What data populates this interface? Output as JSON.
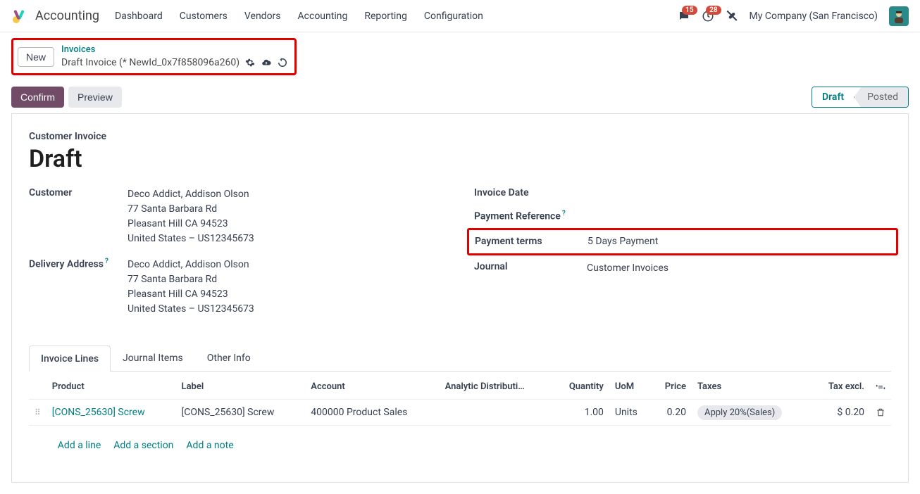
{
  "nav": {
    "app": "Accounting",
    "items": [
      "Dashboard",
      "Customers",
      "Vendors",
      "Accounting",
      "Reporting",
      "Configuration"
    ],
    "msg_badge": "15",
    "activity_badge": "28",
    "company": "My Company (San Francisco)"
  },
  "crumb": {
    "new_btn": "New",
    "parent": "Invoices",
    "current": "Draft Invoice (* NewId_0x7f858096a260)"
  },
  "actions": {
    "confirm": "Confirm",
    "preview": "Preview",
    "status_draft": "Draft",
    "status_posted": "Posted"
  },
  "sheet": {
    "subtitle": "Customer Invoice",
    "title": "Draft",
    "left": {
      "customer_label": "Customer",
      "customer_value": "Deco Addict, Addison Olson\n77 Santa Barbara Rd\nPleasant Hill CA 94523\nUnited States – US12345673",
      "delivery_label": "Delivery Address",
      "delivery_value": "Deco Addict, Addison Olson\n77 Santa Barbara Rd\nPleasant Hill CA 94523\nUnited States – US12345673"
    },
    "right": {
      "invoice_date_label": "Invoice Date",
      "invoice_date_value": "",
      "payref_label": "Payment Reference",
      "payref_value": "",
      "payterms_label": "Payment terms",
      "payterms_value": "5 Days Payment",
      "journal_label": "Journal",
      "journal_value": "Customer Invoices"
    }
  },
  "tabs": [
    "Invoice Lines",
    "Journal Items",
    "Other Info"
  ],
  "table": {
    "headers": {
      "product": "Product",
      "label": "Label",
      "account": "Account",
      "analytic": "Analytic Distributi…",
      "qty": "Quantity",
      "uom": "UoM",
      "price": "Price",
      "taxes": "Taxes",
      "taxexcl": "Tax excl."
    },
    "rows": [
      {
        "product": "[CONS_25630] Screw",
        "label": "[CONS_25630] Screw",
        "account": "400000 Product Sales",
        "analytic": "",
        "qty": "1.00",
        "uom": "Units",
        "price": "0.20",
        "tax": "Apply 20%(Sales)",
        "taxexcl": "$ 0.20"
      }
    ],
    "add_line": "Add a line",
    "add_section": "Add a section",
    "add_note": "Add a note"
  }
}
